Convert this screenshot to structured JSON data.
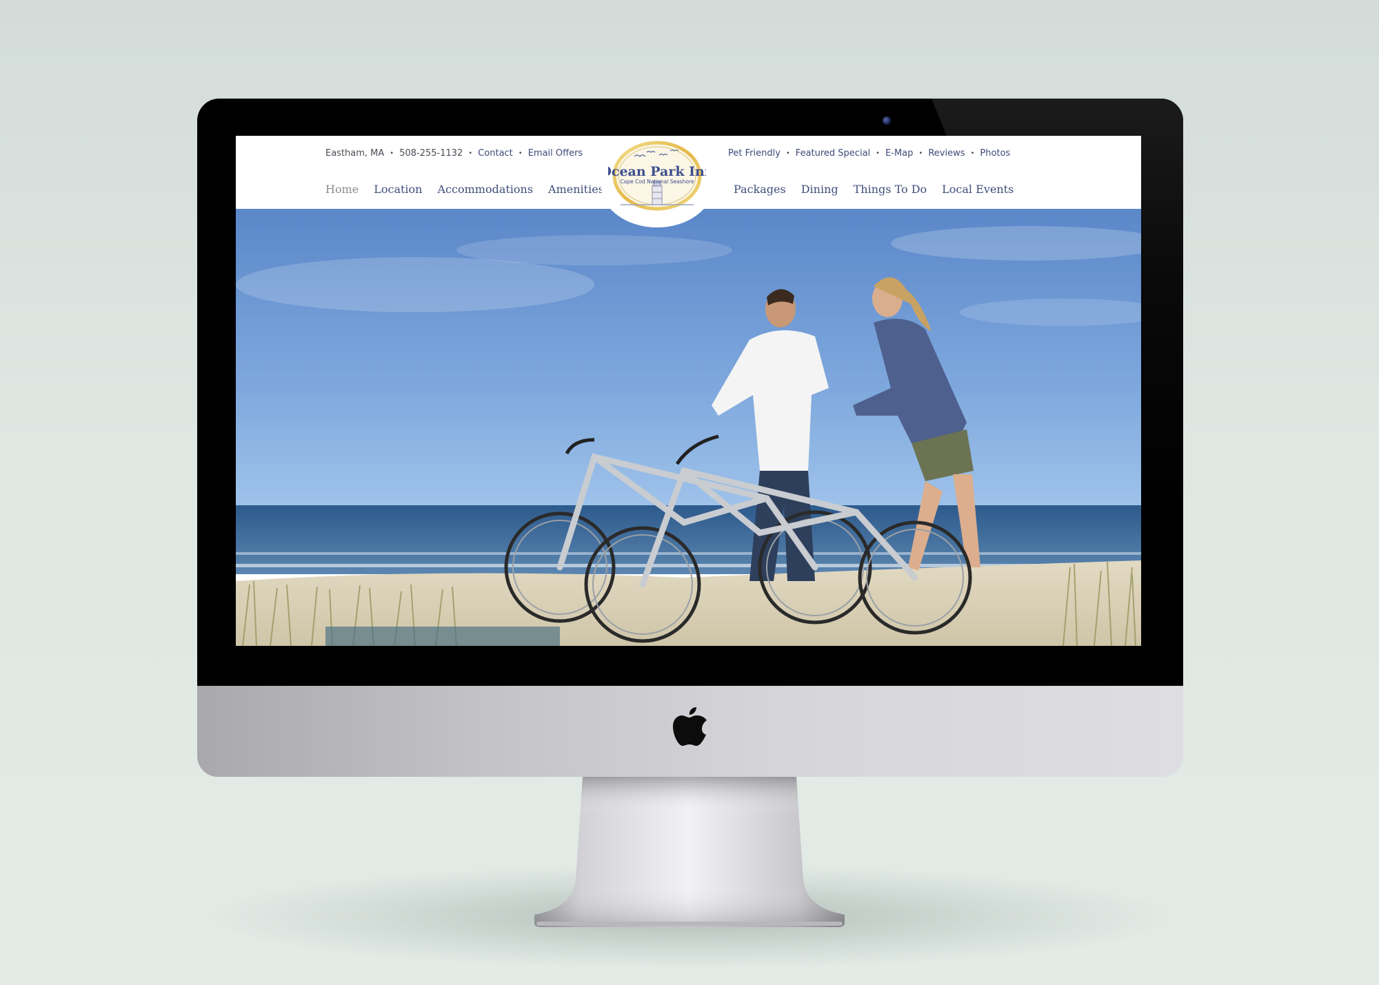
{
  "header": {
    "utility_left": {
      "location": "Eastham, MA",
      "phone": "508-255-1132",
      "contact": "Contact",
      "email_offers": "Email Offers"
    },
    "utility_right": [
      "Pet Friendly",
      "Featured Special",
      "E-Map",
      "Reviews",
      "Photos"
    ],
    "nav_left": [
      "Home",
      "Location",
      "Accommodations",
      "Amenities"
    ],
    "nav_right": [
      "Packages",
      "Dining",
      "Things To Do",
      "Local Events"
    ],
    "current_nav": "Home",
    "logo": {
      "name": "Ocean Park Inn",
      "tagline": "Cape Cod National Seashore"
    }
  },
  "colors": {
    "nav_link": "#3e4e7a",
    "nav_current": "#8c8c8c",
    "logo_ring": "#e8c75a",
    "sky_top": "#5b87c9",
    "sky_horizon": "#9ec2ea",
    "ocean": "#3c6a9c",
    "sand": "#d8d0b8"
  },
  "icons": {
    "hardware_logo": "apple-icon",
    "camera": "webcam-icon"
  }
}
